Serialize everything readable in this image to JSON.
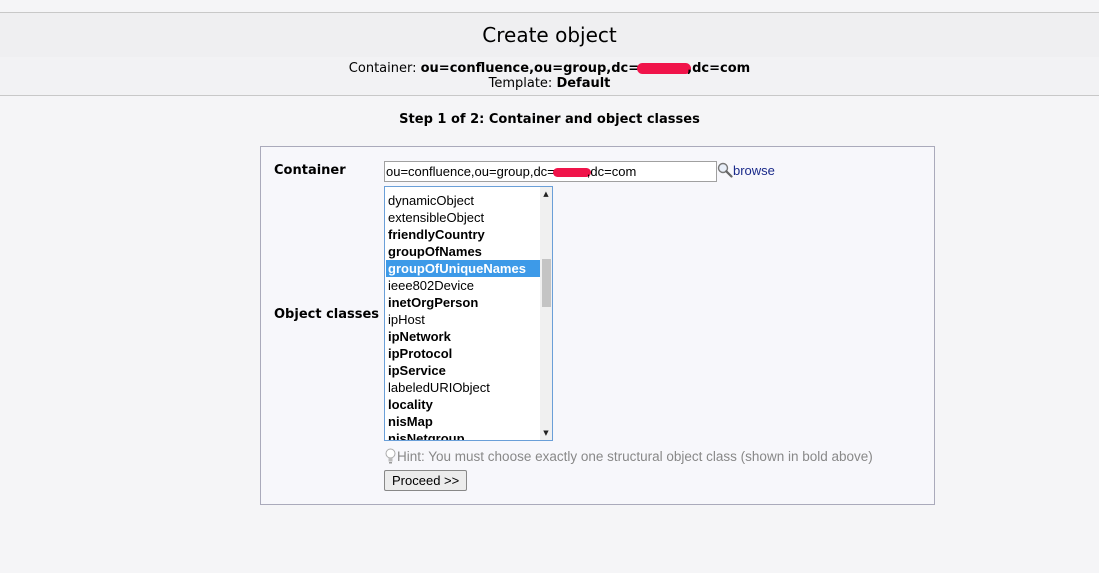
{
  "header": {
    "title": "Create object",
    "container_label": "Container:",
    "container_value_a": "ou=confluence,ou=group,dc=",
    "container_value_b": "dc=com",
    "template_label": "Template:",
    "template_value": "Default"
  },
  "step": {
    "heading": "Step 1 of 2: Container and object classes"
  },
  "form": {
    "container_label": "Container",
    "container_input_a": "ou=confluence,ou=group,dc=",
    "container_input_b": ",dc=com",
    "browse_label": "browse",
    "object_classes_label": "Object classes",
    "object_classes": [
      {
        "name": "dynamicObject",
        "structural": false,
        "selected": false
      },
      {
        "name": "extensibleObject",
        "structural": false,
        "selected": false
      },
      {
        "name": "friendlyCountry",
        "structural": true,
        "selected": false
      },
      {
        "name": "groupOfNames",
        "structural": true,
        "selected": false
      },
      {
        "name": "groupOfUniqueNames",
        "structural": true,
        "selected": true
      },
      {
        "name": "ieee802Device",
        "structural": false,
        "selected": false
      },
      {
        "name": "inetOrgPerson",
        "structural": true,
        "selected": false
      },
      {
        "name": "ipHost",
        "structural": false,
        "selected": false
      },
      {
        "name": "ipNetwork",
        "structural": true,
        "selected": false
      },
      {
        "name": "ipProtocol",
        "structural": true,
        "selected": false
      },
      {
        "name": "ipService",
        "structural": true,
        "selected": false
      },
      {
        "name": "labeledURIObject",
        "structural": false,
        "selected": false
      },
      {
        "name": "locality",
        "structural": true,
        "selected": false
      },
      {
        "name": "nisMap",
        "structural": true,
        "selected": false
      },
      {
        "name": "nisNetgroup",
        "structural": true,
        "selected": false
      }
    ],
    "hint": "Hint: You must choose exactly one structural object class (shown in bold above)",
    "proceed_label": "Proceed >>"
  },
  "colors": {
    "selected_bg": "#3d9ae8",
    "redaction": "#f0144a",
    "link": "#1a2a8a"
  },
  "icons": {
    "browse": "magnifier-icon",
    "hint": "lightbulb-icon"
  }
}
